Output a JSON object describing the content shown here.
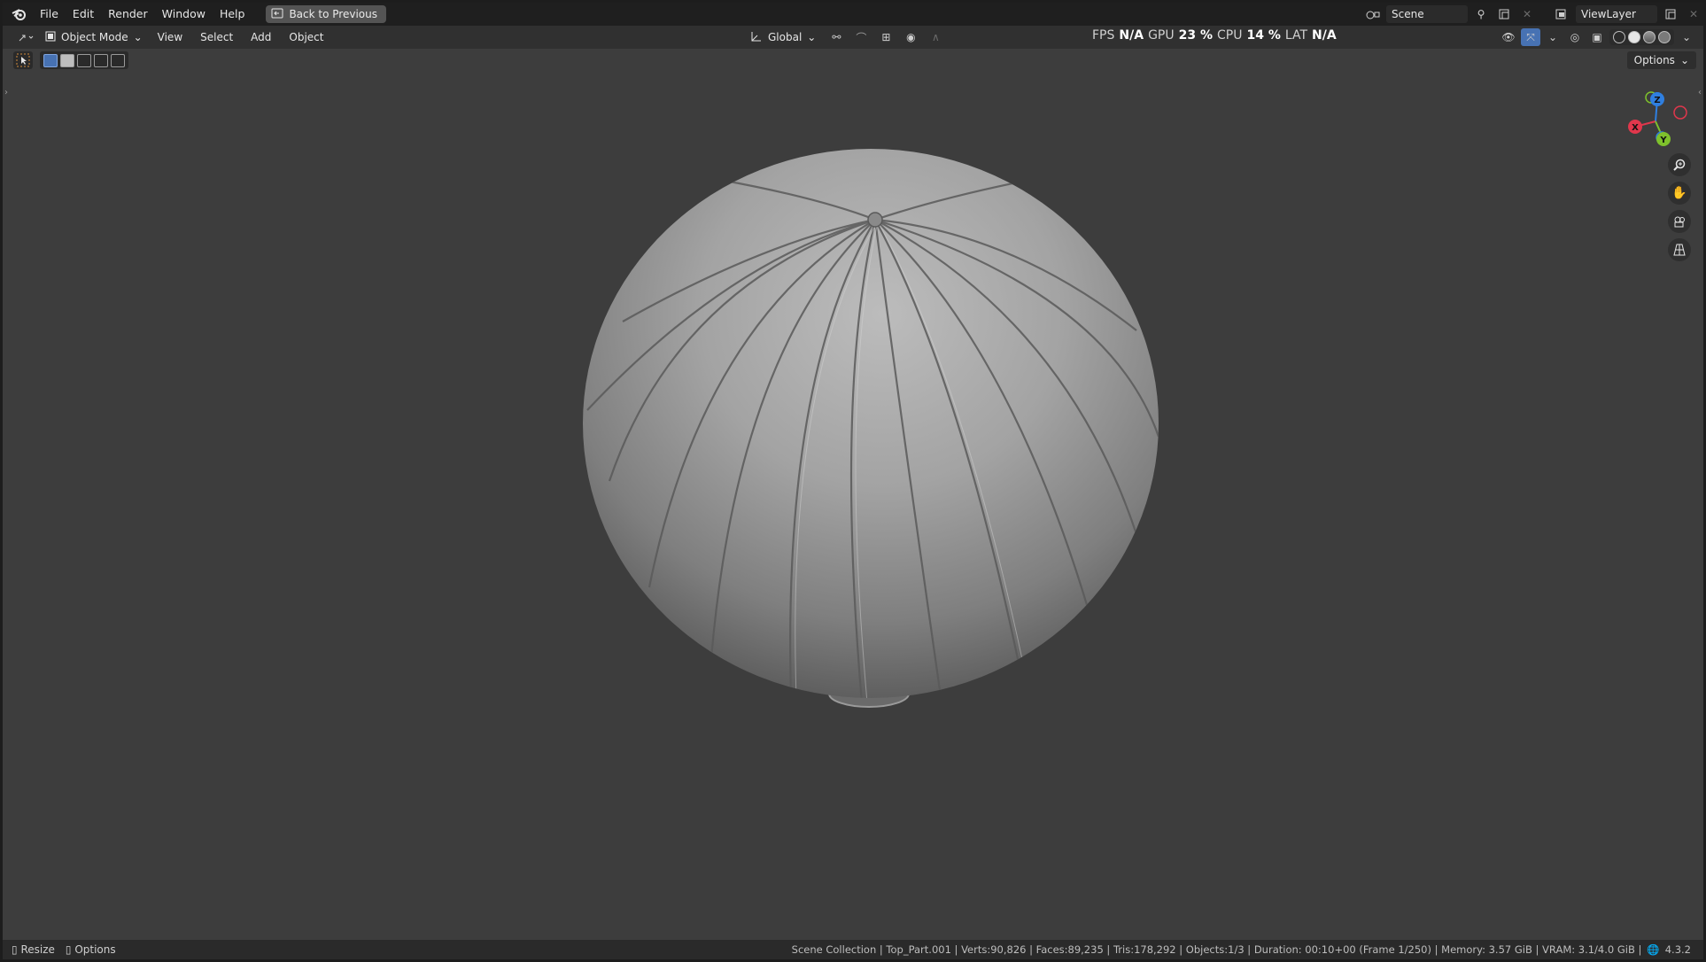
{
  "menubar": {
    "items": [
      "File",
      "Edit",
      "Render",
      "Window",
      "Help"
    ],
    "back_button": "Back to Previous",
    "scene_field": "Scene",
    "viewlayer_field": "ViewLayer"
  },
  "viewport_header": {
    "mode": "Object Mode",
    "menus": [
      "View",
      "Select",
      "Add",
      "Object"
    ],
    "transform_orientation": "Global",
    "options_label": "Options"
  },
  "stats": {
    "fps_label": "FPS",
    "fps_value": "N/A",
    "gpu_label": "GPU",
    "gpu_value": "23 %",
    "cpu_label": "CPU",
    "cpu_value": "14 %",
    "lat_label": "LAT",
    "lat_value": "N/A"
  },
  "gizmo": {
    "x": "X",
    "y": "Y",
    "z": "Z",
    "colors": {
      "x": "#e0374c",
      "y": "#7ec12c",
      "z": "#2f7fe0"
    }
  },
  "statusbar": {
    "left": [
      "Resize",
      "Options"
    ],
    "right": "Scene Collection | Top_Part.001 | Verts:90,826 | Faces:89,235 | Tris:178,292 | Objects:1/3 | Duration: 00:10+00 (Frame 1/250) | Memory: 3.57 GiB | VRAM: 3.1/4.0 GiB |",
    "version": "4.3.2"
  }
}
